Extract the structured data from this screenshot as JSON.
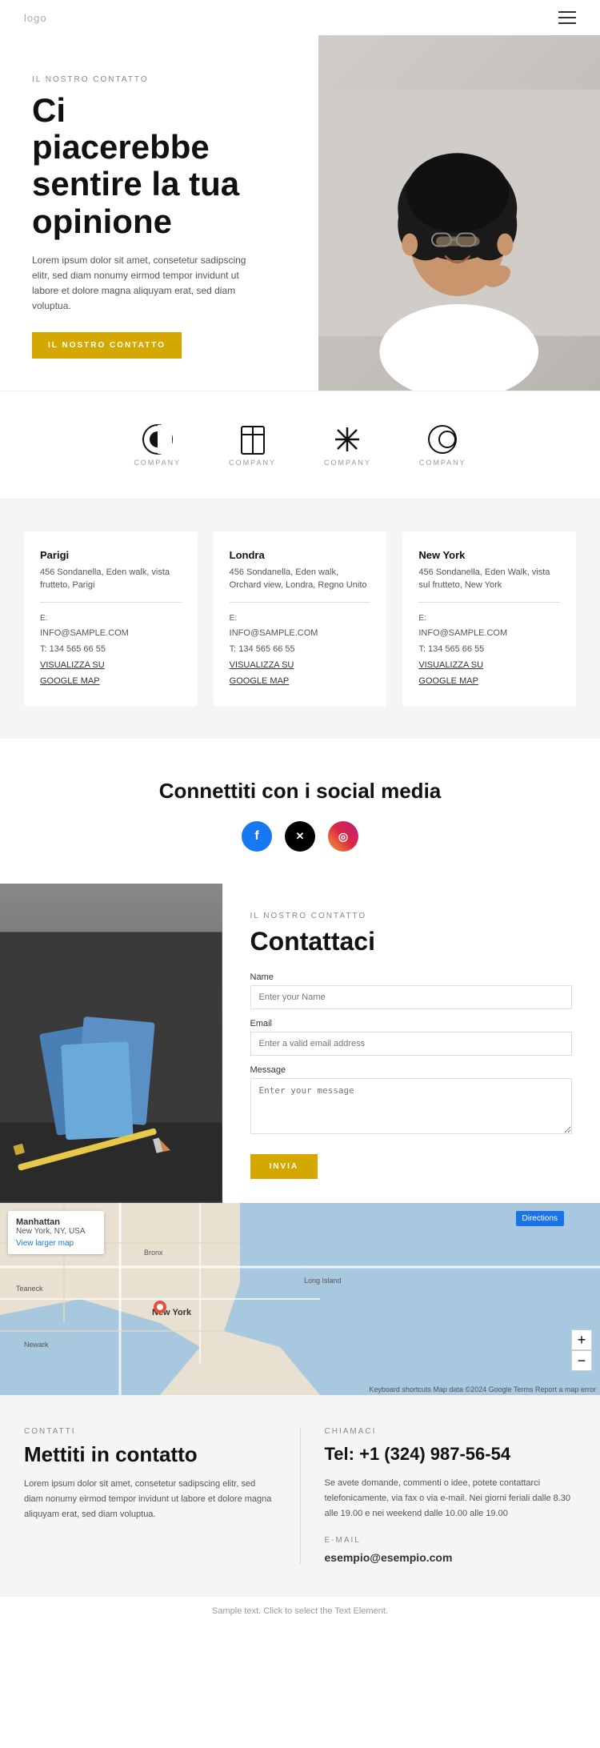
{
  "header": {
    "logo": "logo",
    "menu_icon": "☰"
  },
  "hero": {
    "subtitle": "IL NOSTRO CONTATTO",
    "title_line1": "Ci",
    "title_line2": "piacerebbe",
    "title_line3": "sentire la tua",
    "title_line4": "opinione",
    "title_full": "Ci piacerebbe sentire la tua opinione",
    "description": "Lorem ipsum dolor sit amet, consetetur sadipscing elitr, sed diam nonumy eirmod tempor invidunt ut labore et dolore magna aliquyam erat, sed diam voluptua.",
    "cta_button": "IL NOSTRO CONTATTO"
  },
  "logos": [
    {
      "label": "COMPANY",
      "icon": "circle-half"
    },
    {
      "label": "COMPANY",
      "icon": "book-open"
    },
    {
      "label": "COMPANY",
      "icon": "check-lines"
    },
    {
      "label": "COMPANY",
      "icon": "circle-link"
    }
  ],
  "offices": [
    {
      "city": "Parigi",
      "address": "456 Sondanella, Eden walk, vista frutteto, Parigi",
      "email_label": "E:",
      "email": "INFO@SAMPLE.COM",
      "phone_label": "T:",
      "phone": "134 565 66 55",
      "map_link1": "VISUALIZZA SU",
      "map_link2": "GOOGLE MAP"
    },
    {
      "city": "Londra",
      "address": "456 Sondanella, Eden walk, Orchard view, Londra, Regno Unito",
      "email_label": "E:",
      "email": "INFO@SAMPLE.COM",
      "phone_label": "T:",
      "phone": "134 565 66 55",
      "map_link1": "VISUALIZZA SU",
      "map_link2": "GOOGLE MAP"
    },
    {
      "city": "New York",
      "address": "456 Sondanella, Eden Walk, vista sul frutteto, New York",
      "email_label": "E:",
      "email": "INFO@SAMPLE.COM",
      "phone_label": "T:",
      "phone": "134 565 66 55",
      "map_link1": "VISUALIZZA SU",
      "map_link2": "GOOGLE MAP"
    }
  ],
  "social": {
    "title": "Connettiti con i social media",
    "facebook": "f",
    "twitter": "𝕏",
    "instagram": "◎"
  },
  "contact_form": {
    "subtitle": "IL NOSTRO CONTATTO",
    "title": "Contattaci",
    "name_label": "Name",
    "name_placeholder": "Enter your Name",
    "email_label": "Email",
    "email_placeholder": "Enter a valid email address",
    "message_label": "Message",
    "message_placeholder": "Enter your message",
    "submit_button": "INVIA"
  },
  "map": {
    "location_name": "Manhattan",
    "location_sub": "New York, NY, USA",
    "view_larger": "View larger map",
    "directions": "Directions",
    "attribution": "Keyboard shortcuts  Map data ©2024 Google  Terms  Report a map error",
    "zoom_in": "+",
    "zoom_out": "−"
  },
  "bottom": {
    "left_tag": "CONTATTI",
    "left_title": "Mettiti in contatto",
    "left_desc": "Lorem ipsum dolor sit amet, consetetur sadipscing elitr, sed diam nonumy eirmod tempor invidunt ut labore et dolore magna aliquyam erat, sed diam voluptua.",
    "right_tag": "CHIAMACI",
    "phone": "Tel: +1 (324) 987-56-54",
    "call_desc": "Se avete domande, commenti o idee, potete contattarci telefonicamente, via fax o via e-mail. Nei giorni feriali dalle 8.30 alle 19.00 e nei weekend dalle 10.00 alle 19.00",
    "email_label": "E-MAIL",
    "email": "esempio@esempio.com"
  },
  "footer": {
    "text": "Sample text. Click to select the Text Element."
  }
}
